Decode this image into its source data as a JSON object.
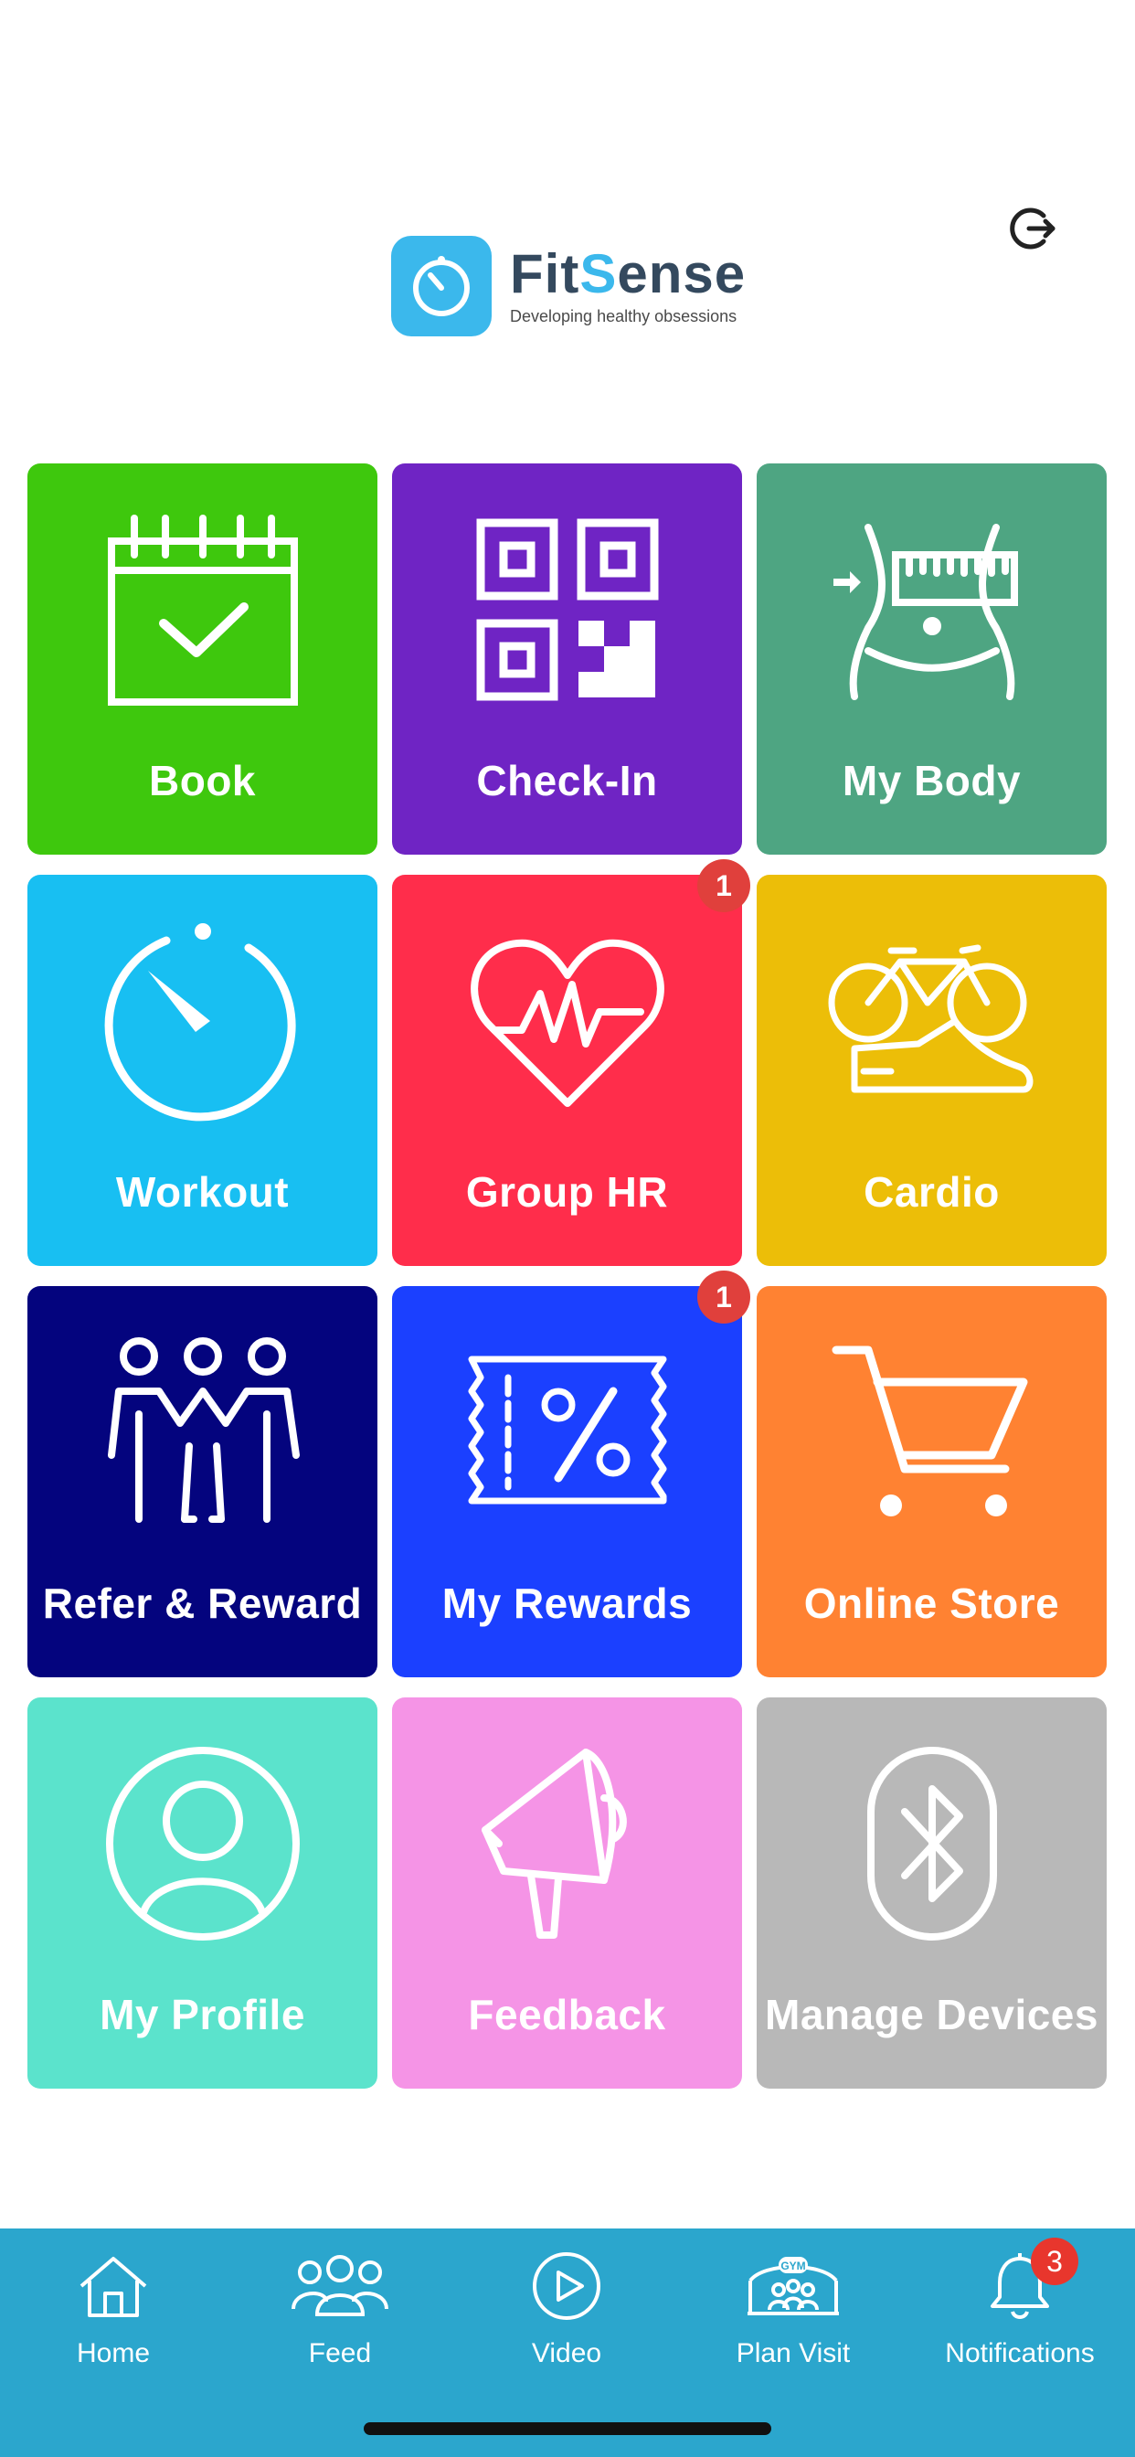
{
  "brand": {
    "name_part1": "Fit",
    "name_part2_s": "S",
    "name_part3": "ense",
    "tagline": "Developing healthy obsessions"
  },
  "colors": {
    "book": "#3ec80d",
    "checkin": "#6f24c4",
    "mybody": "#4ea582",
    "workout": "#18bff2",
    "grouphr": "#ff2d4b",
    "cardio": "#ecbe08",
    "refer": "#04047e",
    "rewards": "#1b40ff",
    "store": "#ff8232",
    "profile": "#5be3cc",
    "feedback": "#f594e6",
    "devices": "#b8b8b8",
    "tabbar": "#2ba6cd",
    "badge": "#e0403c"
  },
  "tiles": [
    {
      "label": "Book",
      "icon": "calendar-check-icon"
    },
    {
      "label": "Check-In",
      "icon": "qr-code-icon"
    },
    {
      "label": "My Body",
      "icon": "body-measure-icon"
    },
    {
      "label": "Workout",
      "icon": "stopwatch-icon"
    },
    {
      "label": "Group HR",
      "icon": "heart-rate-icon",
      "badge": "1"
    },
    {
      "label": "Cardio",
      "icon": "bike-shoe-icon"
    },
    {
      "label": "Refer & Reward",
      "icon": "people-icon"
    },
    {
      "label": "My Rewards",
      "icon": "discount-ticket-icon",
      "badge": "1"
    },
    {
      "label": "Online Store",
      "icon": "cart-icon"
    },
    {
      "label": "My Profile",
      "icon": "user-circle-icon"
    },
    {
      "label": "Feedback",
      "icon": "megaphone-icon"
    },
    {
      "label": "Manage Devices",
      "icon": "bluetooth-icon"
    }
  ],
  "tabbar": {
    "items": [
      {
        "label": "Home",
        "icon": "home-icon"
      },
      {
        "label": "Feed",
        "icon": "group-icon"
      },
      {
        "label": "Video",
        "icon": "play-icon"
      },
      {
        "label": "Plan Visit",
        "icon": "gym-icon",
        "icon_text": "GYM"
      },
      {
        "label": "Notifications",
        "icon": "bell-icon",
        "badge": "3"
      }
    ]
  }
}
